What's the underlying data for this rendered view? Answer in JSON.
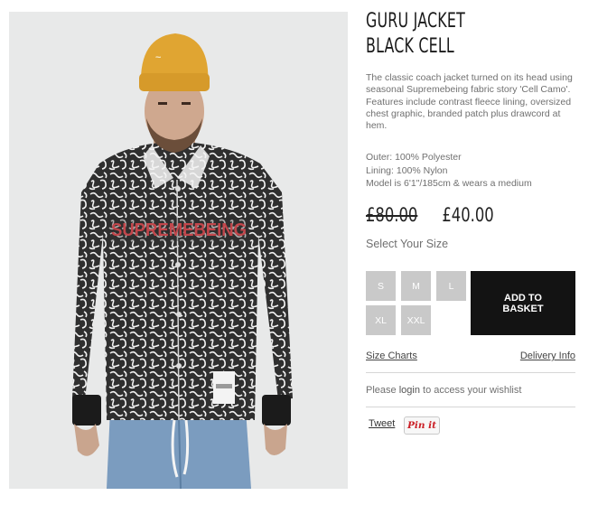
{
  "product": {
    "title_line1": "GURU JACKET",
    "title_line2": "BLACK CELL",
    "description": "The classic coach jacket turned on its head using seasonal Supremebeing fabric story 'Cell Camo'. Features include contrast fleece lining, oversized chest graphic, branded patch plus drawcord at hem.",
    "specs": [
      "Outer: 100% Polyester",
      "Lining: 100% Nylon",
      "Model is 6'1\"/185cm & wears a medium"
    ],
    "old_price": "£80.00",
    "price": "£40.00"
  },
  "sizes": {
    "label": "Select Your Size",
    "options": [
      "S",
      "M",
      "L",
      "XL",
      "XXL"
    ]
  },
  "basket": {
    "line1": "ADD TO",
    "line2": "BASKET"
  },
  "links": {
    "size_charts": "Size Charts",
    "delivery_info": "Delivery Info"
  },
  "wishlist": {
    "prefix": "Please ",
    "login": "login",
    "suffix": " to access your wishlist"
  },
  "social": {
    "tweet": "Tweet",
    "pinit": "Pin it"
  },
  "photo": {
    "chest_graphic": "SUPREMEBEING",
    "beanie_color": "#e0a532",
    "jacket_color": "#3a3a3a",
    "jeans_color": "#7b9cbf"
  }
}
